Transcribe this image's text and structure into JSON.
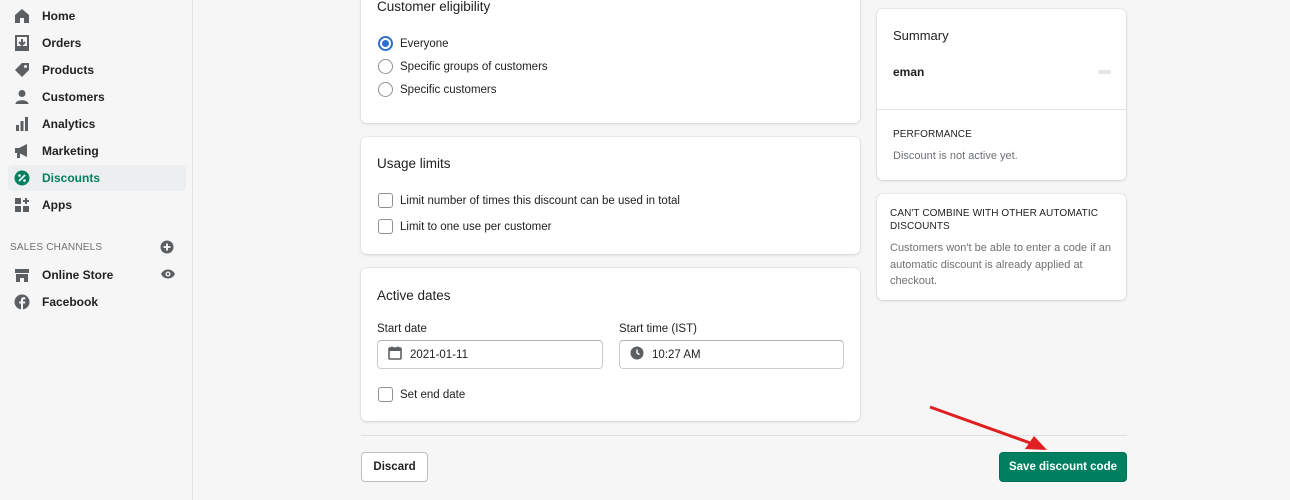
{
  "sidebar": {
    "items": [
      {
        "label": "Home",
        "icon": "home-icon"
      },
      {
        "label": "Orders",
        "icon": "orders-icon"
      },
      {
        "label": "Products",
        "icon": "tag-icon"
      },
      {
        "label": "Customers",
        "icon": "person-icon"
      },
      {
        "label": "Analytics",
        "icon": "bar-chart-icon"
      },
      {
        "label": "Marketing",
        "icon": "megaphone-icon"
      },
      {
        "label": "Discounts",
        "icon": "discount-icon",
        "active": true
      },
      {
        "label": "Apps",
        "icon": "apps-icon"
      }
    ],
    "sales_channels_title": "SALES CHANNELS",
    "channels": [
      {
        "label": "Online Store",
        "icon": "store-icon"
      },
      {
        "label": "Facebook",
        "icon": "facebook-icon"
      }
    ]
  },
  "eligibility": {
    "title": "Customer eligibility",
    "options": [
      "Everyone",
      "Specific groups of customers",
      "Specific customers"
    ],
    "selected": "Everyone"
  },
  "usage": {
    "title": "Usage limits",
    "options": [
      "Limit number of times this discount can be used in total",
      "Limit to one use per customer"
    ]
  },
  "dates": {
    "title": "Active dates",
    "start_date_label": "Start date",
    "start_date": "2021-01-11",
    "start_time_label": "Start time (IST)",
    "start_time": "10:27 AM",
    "end_date_label": "Set end date"
  },
  "summary": {
    "title": "Summary",
    "code": "eman",
    "performance_title": "PERFORMANCE",
    "performance_text": "Discount is not active yet."
  },
  "combine": {
    "title": "CAN'T COMBINE WITH OTHER AUTOMATIC DISCOUNTS",
    "text": "Customers won't be able to enter a code if an automatic discount is already applied at checkout."
  },
  "actions": {
    "discard": "Discard",
    "save": "Save discount code"
  },
  "colors": {
    "accent": "#008060",
    "radio": "#2c6ecb",
    "annotation_arrow": "#e02020"
  }
}
